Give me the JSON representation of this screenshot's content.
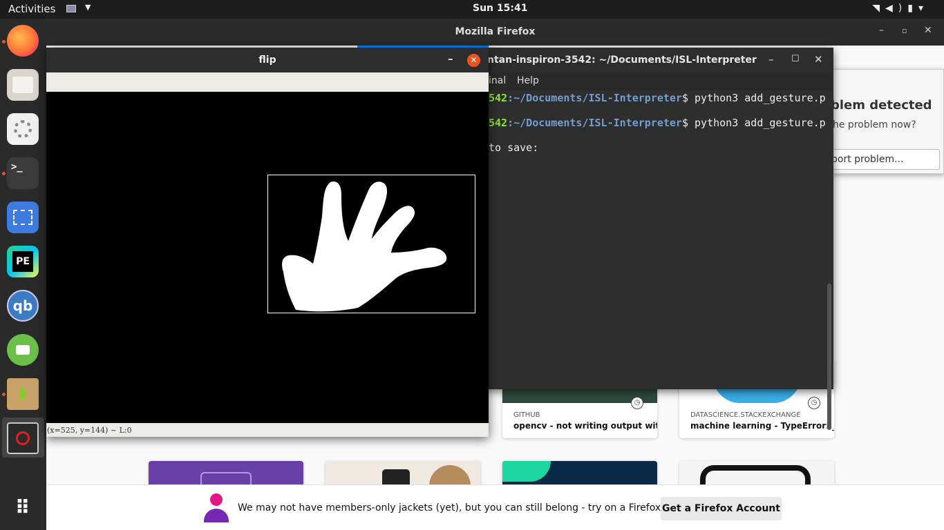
{
  "topbar": {
    "activities": "Activities",
    "clock": "Sun 15:41",
    "tray_icons": [
      "wifi-icon",
      "volume-icon",
      "battery-icon",
      "chevron-down-icon"
    ]
  },
  "dock": {
    "apps": [
      "firefox",
      "files",
      "settings",
      "terminal",
      "screenshot",
      "pycharm-edu",
      "qbittorrent",
      "cloud-sync",
      "archive-manager",
      "flip-app",
      "show-applications"
    ]
  },
  "firefox": {
    "window_title": "Mozilla Firefox",
    "cards": [
      {
        "source": "GITHUB",
        "title": "opencv - not writing output with..."
      },
      {
        "source": "DATASCIENCE.STACKEXCHANGE",
        "title": "machine learning - TypeError: _..."
      }
    ],
    "notice": {
      "message": "We may not have members-only jackets (yet), but you can still belong - try on a Firefox Account.",
      "button": "Get a Firefox Account"
    }
  },
  "problem_popup": {
    "heading": "blem detected",
    "question": "he problem now?",
    "button": "port problem..."
  },
  "terminal": {
    "title": "ntan-inspiron-3542: ~/Documents/ISL-Interpreter",
    "menu": [
      "inal",
      "Help"
    ],
    "lines": [
      {
        "host": "542",
        "path": ":~/Documents/ISL-Interpreter",
        "cmd": "$ python3 add_gesture.p"
      },
      {
        "host": "542",
        "path": ":~/Documents/ISL-Interpreter",
        "cmd": "$ python3 add_gesture.p"
      }
    ],
    "prompt_line": "to save:"
  },
  "flip_window": {
    "title": "flip",
    "status": "(x=525, y=144) ~ L:0"
  },
  "colors": {
    "accent_orange": "#e95420",
    "terminal_green": "#8ae234",
    "terminal_blue": "#729fcf"
  }
}
